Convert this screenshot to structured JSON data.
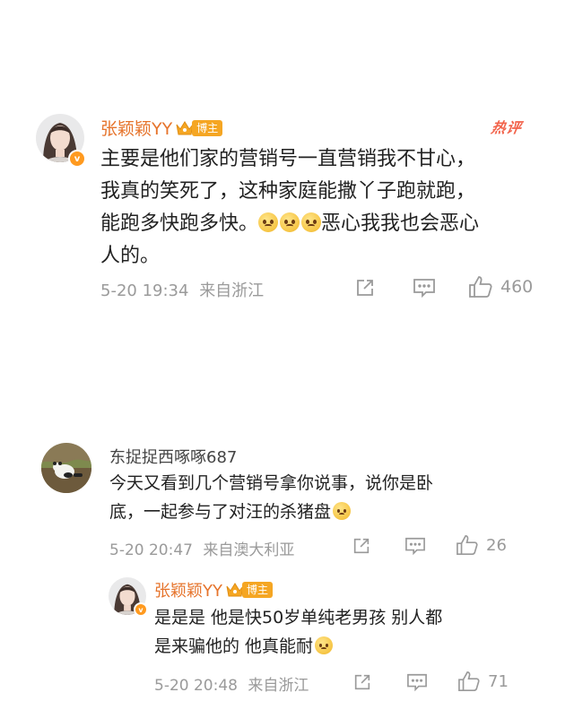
{
  "comments": [
    {
      "username": "张颖颖YY",
      "badge": "博主",
      "hot_label": "热评",
      "text_line1": "主要是他们家的营销号一直营销我不甘心，",
      "text_line2": "我真的笑死了，这种家庭能撒丫子跑就跑，",
      "text_line3a": "能跑多快跑多快。",
      "text_line3b": "恶心我我也会恶心",
      "text_line4": "人的。",
      "time": "5-20 19:34",
      "location": "来自浙江",
      "likes": "460"
    },
    {
      "username": "东捉捉西啄啄687",
      "text_line1": "今天又看到几个营销号拿你说事，说你是卧",
      "text_line2": "底，一起参与了对汪的杀猪盘",
      "time": "5-20 20:47",
      "location": "来自澳大利亚",
      "likes": "26"
    },
    {
      "username": "张颖颖YY",
      "badge": "博主",
      "text_line1": "是是是 他是快50岁单纯老男孩 别人都",
      "text_line2": "是来骗他的 他真能耐",
      "time": "5-20 20:48",
      "location": "来自浙江",
      "likes": "71"
    }
  ],
  "icons": {
    "verified": "v-badge-icon",
    "share": "share-icon",
    "comment": "comment-icon",
    "like": "thumbs-up-icon",
    "emoji": "pleading-face-emoji",
    "laugh": "laughing-crying-emoji"
  },
  "colors": {
    "username": "#e6742c",
    "badge": "#f5a623",
    "hot": "#f2634b",
    "meta": "#9a9a9a"
  }
}
